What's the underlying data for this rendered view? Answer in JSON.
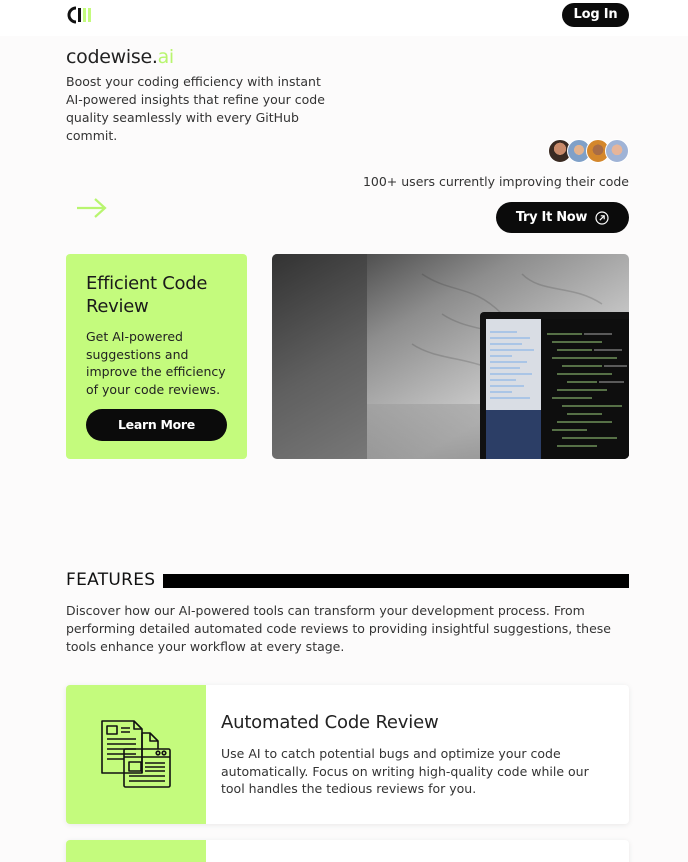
{
  "header": {
    "logo_icon": "codewise-logo-icon",
    "login_label": "Log In"
  },
  "hero": {
    "brand_main": "codewise.",
    "brand_accent": "ai",
    "description": "Boost your coding efficiency with instant AI-powered insights that refine your code quality seamlessly with every GitHub commit.",
    "users_text": "100+ users currently improving their code",
    "arrow_icon": "arrow-right-icon",
    "try_label": "Try It Now",
    "try_icon": "arrow-up-right-circle-icon"
  },
  "promo": {
    "title": "Efficient Code Review",
    "description": "Get AI-powered suggestions and improve the efficiency of your code reviews.",
    "button_label": "Learn More"
  },
  "features": {
    "title": "FEATURES",
    "description": "Discover how our AI-powered tools can transform your development process. From performing detailed automated code reviews to providing insightful suggestions, these tools enhance your workflow at every stage.",
    "items": [
      {
        "icon": "documents-icon",
        "title": "Automated Code Review",
        "description": "Use AI to catch potential bugs and optimize your code automatically. Focus on writing high-quality code while our tool handles the tedious reviews for you."
      }
    ]
  },
  "colors": {
    "accent": "#c4fb7d",
    "dark": "#0b0b0b"
  }
}
